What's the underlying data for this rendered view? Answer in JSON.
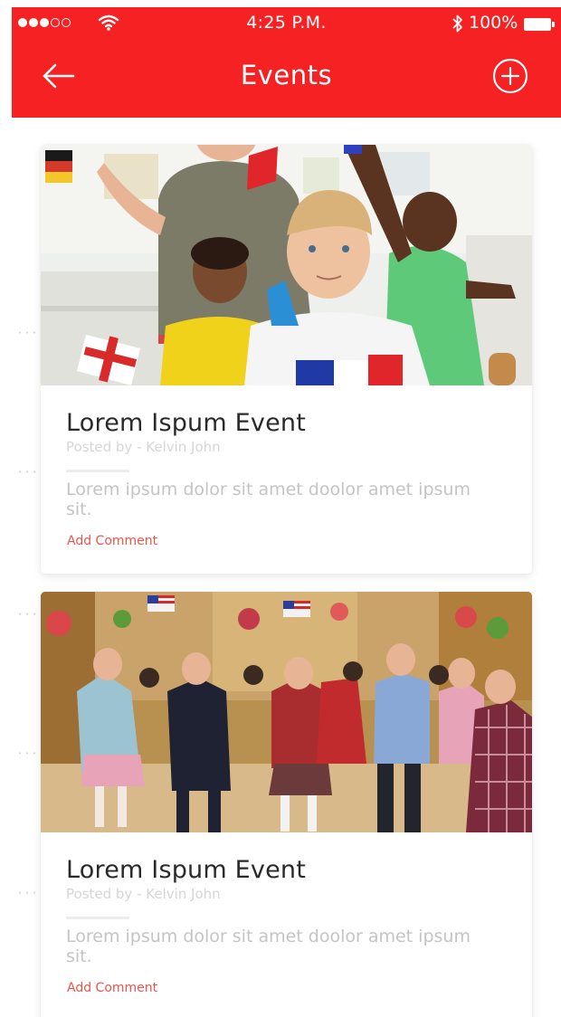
{
  "status_bar": {
    "time": "4:25 P.M.",
    "battery": "100%",
    "signal_icon": "signal-dots-icon",
    "wifi_icon": "wifi-icon",
    "bluetooth_icon": "bluetooth-icon",
    "battery_icon": "battery-icon"
  },
  "header": {
    "title": "Events",
    "back_icon": "arrow-left-icon",
    "add_icon": "plus-circle-icon",
    "color": "#f52123"
  },
  "events": [
    {
      "title": "Lorem Ispum Event",
      "posted_by": "Posted by - Kelvin John",
      "description": "Lorem ipsum dolor sit amet doolor amet ipsum sit.",
      "comment_label": "Add Comment",
      "image": "classroom-children-with-flags"
    },
    {
      "title": "Lorem Ispum Event",
      "posted_by": "Posted by - Kelvin John",
      "description": "Lorem ipsum dolor sit amet doolor amet ipsum sit.",
      "comment_label": "Add Comment",
      "image": "children-celebrating-with-flags-in-hall"
    }
  ],
  "colors": {
    "accent": "#f52123",
    "link": "#e8554b",
    "title_text": "#2a2a2a",
    "muted_text": "#c4c4c4"
  }
}
